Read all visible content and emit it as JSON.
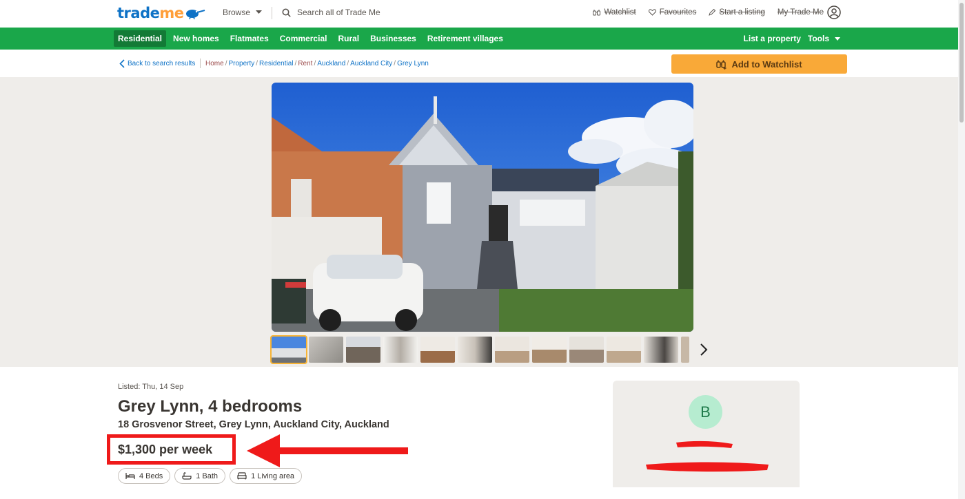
{
  "logo": {
    "part1": "trade",
    "part2": "me"
  },
  "header": {
    "browse_label": "Browse",
    "search_placeholder": "Search all of Trade Me",
    "links": {
      "watchlist": "Watchlist",
      "favourites": "Favourites",
      "start_listing": "Start a listing",
      "my_trade_me": "My Trade Me"
    }
  },
  "nav": {
    "items": [
      "Residential",
      "New homes",
      "Flatmates",
      "Commercial",
      "Rural",
      "Businesses",
      "Retirement villages"
    ],
    "right": {
      "list_property": "List a property",
      "tools": "Tools"
    }
  },
  "breadcrumb": {
    "back": "Back to search results",
    "items": [
      "Home",
      "Property",
      "Residential",
      "Rent",
      "Auckland",
      "Auckland City",
      "Grey Lynn"
    ]
  },
  "actions": {
    "add_to_watchlist": "Add to Watchlist"
  },
  "listing": {
    "listed": "Listed: Thu, 14 Sep",
    "title": "Grey Lynn, 4 bedrooms",
    "address": "18 Grosvenor Street, Grey Lynn, Auckland City, Auckland",
    "price": "$1,300 per week",
    "features": {
      "beds": "4 Beds",
      "bath": "1 Bath",
      "living": "1 Living area"
    }
  },
  "agent": {
    "initial": "B"
  },
  "colors": {
    "brand_green": "#1aa74a",
    "brand_blue": "#0e72c6",
    "watchlist_orange": "#f9a938",
    "annotation_red": "#ef1a1a"
  },
  "icons": [
    "chevron-down-icon",
    "search-icon",
    "binoculars-icon",
    "heart-icon",
    "pencil-icon",
    "user-circle-icon",
    "chevron-left-icon",
    "chevron-right-icon",
    "bed-icon",
    "bath-icon",
    "sofa-icon"
  ]
}
